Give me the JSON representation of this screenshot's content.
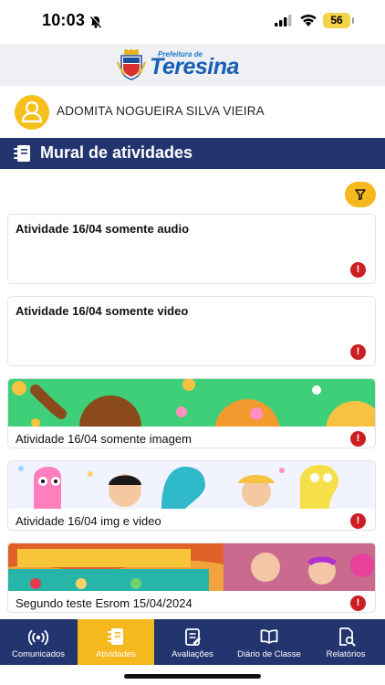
{
  "status_bar": {
    "time": "10:03",
    "battery": "56"
  },
  "brand": {
    "small_text": "Prefeitura de",
    "name": "Teresina"
  },
  "user": {
    "name": "ADOMITA NOGUEIRA SILVA VIEIRA"
  },
  "section": {
    "title": "Mural de atividades"
  },
  "activities": [
    {
      "title": "Atividade 16/04 somente audio",
      "has_image": false
    },
    {
      "title": "Atividade 16/04 somente video",
      "has_image": false
    },
    {
      "title": "Atividade 16/04 somente imagem",
      "has_image": true
    },
    {
      "title": "Atividade 16/04 img e video",
      "has_image": true
    },
    {
      "title": "Segundo teste Esrom 15/04/2024",
      "has_image": true
    }
  ],
  "bottom_nav": [
    {
      "label": "Comunicados",
      "icon": "broadcast-icon",
      "active": false
    },
    {
      "label": "Atividades",
      "icon": "notebook-icon",
      "active": true
    },
    {
      "label": "Avaliações",
      "icon": "clipboard-icon",
      "active": false
    },
    {
      "label": "Diário de Classe",
      "icon": "book-icon",
      "active": false
    },
    {
      "label": "Relatórios",
      "icon": "report-search-icon",
      "active": false
    }
  ],
  "colors": {
    "navy": "#23356e",
    "accent": "#f6b81f",
    "alert": "#cc1f24",
    "brand_blue": "#1860b4"
  }
}
